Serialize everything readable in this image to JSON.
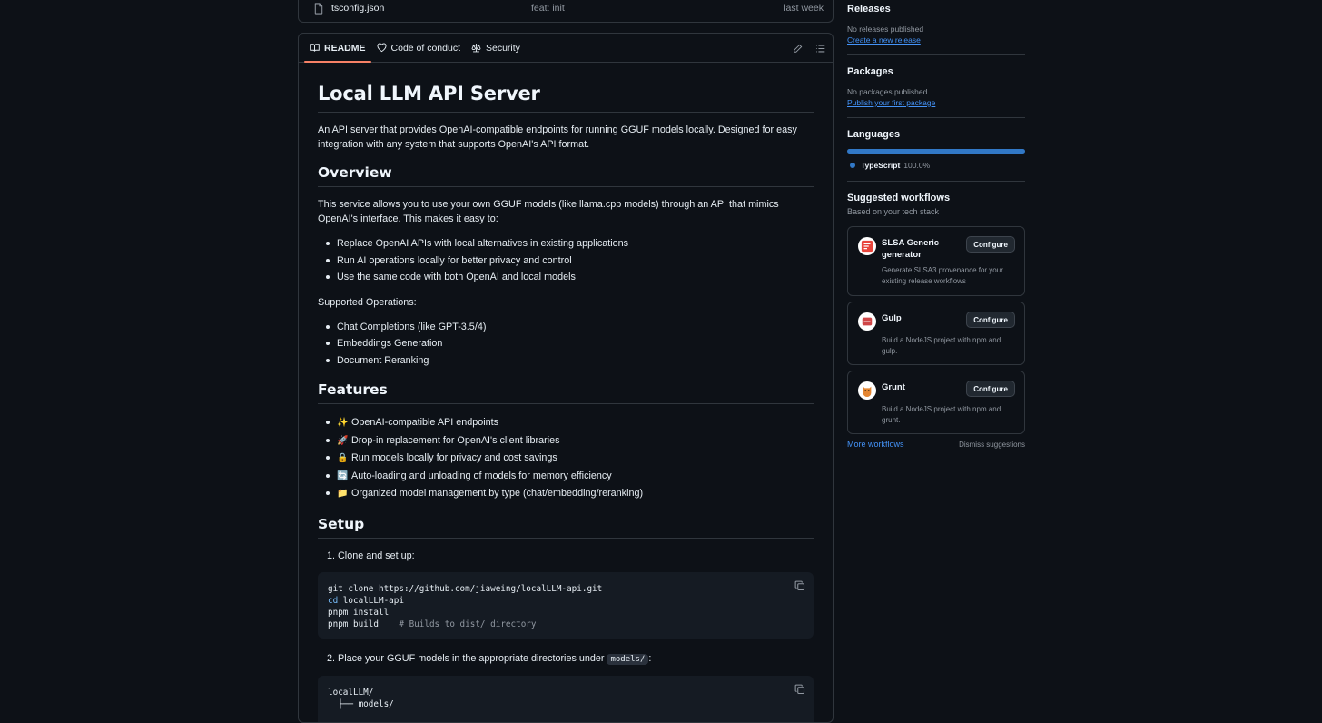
{
  "file_row": {
    "name": "tsconfig.json",
    "message": "feat: init",
    "time": "last week"
  },
  "readme_tabs": [
    {
      "label": "README",
      "icon": "book-icon"
    },
    {
      "label": "Code of conduct",
      "icon": "heart-icon"
    },
    {
      "label": "Security",
      "icon": "law-icon"
    }
  ],
  "readme": {
    "title": "Local LLM API Server",
    "intro": "An API server that provides OpenAI-compatible endpoints for running GGUF models locally. Designed for easy integration with any system that supports OpenAI's API format.",
    "overview_heading": "Overview",
    "overview_text": "This service allows you to use your own GGUF models (like llama.cpp models) through an API that mimics OpenAI's interface. This makes it easy to:",
    "overview_items": [
      "Replace OpenAI APIs with local alternatives in existing applications",
      "Run AI operations locally for better privacy and control",
      "Use the same code with both OpenAI and local models"
    ],
    "supported_label": "Supported Operations:",
    "supported_items": [
      "Chat Completions (like GPT-3.5/4)",
      "Embeddings Generation",
      "Document Reranking"
    ],
    "features_heading": "Features",
    "features": [
      {
        "emoji": "✨",
        "text": "OpenAI-compatible API endpoints"
      },
      {
        "emoji": "🚀",
        "text": "Drop-in replacement for OpenAI's client libraries"
      },
      {
        "emoji": "🔒",
        "text": "Run models locally for privacy and cost savings"
      },
      {
        "emoji": "🔄",
        "text": "Auto-loading and unloading of models for memory efficiency"
      },
      {
        "emoji": "📁",
        "text": "Organized model management by type (chat/embedding/reranking)"
      }
    ],
    "setup_heading": "Setup",
    "step1": "1. Clone and set up:",
    "code1": {
      "line1": "git clone https://github.com/jiaweing/localLLM-api.git",
      "line2_kw": "cd",
      "line2_rest": " localLLM-api",
      "line3": "pnpm install",
      "line4": "pnpm build",
      "line4_comment": "# Builds to dist/ directory"
    },
    "step2_prefix": "2. Place your GGUF models in the appropriate directories under",
    "step2_code": "models/",
    "step2_suffix": ":",
    "code2": {
      "line1": "localLLM/",
      "line2": "  ├── models/"
    }
  },
  "sidebar": {
    "releases": {
      "heading": "Releases",
      "muted": "No releases published",
      "link": "Create a new release"
    },
    "packages": {
      "heading": "Packages",
      "muted": "No packages published",
      "link": "Publish your first package"
    },
    "languages": {
      "heading": "Languages",
      "name": "TypeScript",
      "percent": "100.0%",
      "color": "#3178c6"
    },
    "workflows": {
      "heading": "Suggested workflows",
      "subheading": "Based on your tech stack",
      "button_label": "Configure",
      "items": [
        {
          "title": "SLSA Generic generator",
          "desc": "Generate SLSA3 provenance for your existing release workflows",
          "logo": "slsa-logo-icon"
        },
        {
          "title": "Gulp",
          "desc": "Build a NodeJS project with npm and gulp.",
          "logo": "gulp-logo-icon"
        },
        {
          "title": "Grunt",
          "desc": "Build a NodeJS project with npm and grunt.",
          "logo": "grunt-logo-icon"
        }
      ],
      "more": "More workflows",
      "dismiss": "Dismiss suggestions"
    }
  }
}
